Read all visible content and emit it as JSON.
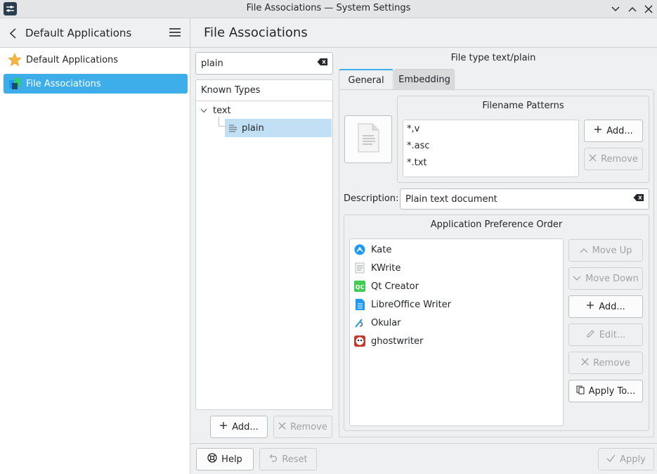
{
  "window": {
    "title": "File Associations — System Settings"
  },
  "header": {
    "back_label": "Default Applications",
    "page_title": "File Associations"
  },
  "sidebar": {
    "items": [
      {
        "label": "Default Applications"
      },
      {
        "label": "File Associations"
      }
    ]
  },
  "left_panel": {
    "search_value": "plain",
    "tree_header": "Known Types",
    "tree": {
      "parent": "text",
      "child": "plain"
    },
    "add_label": "Add...",
    "remove_label": "Remove"
  },
  "right_panel": {
    "file_type_title": "File type text/plain",
    "tabs": [
      {
        "label": "General"
      },
      {
        "label": "Embedding"
      }
    ],
    "patterns_title": "Filename Patterns",
    "patterns": [
      "*,v",
      "*.asc",
      "*.txt"
    ],
    "patterns_add": "Add...",
    "patterns_remove": "Remove",
    "description_label": "Description:",
    "description_value": "Plain text document",
    "app_order_title": "Application Preference Order",
    "apps": [
      {
        "name": "Kate",
        "icon": "kate-icon"
      },
      {
        "name": "KWrite",
        "icon": "kwrite-icon"
      },
      {
        "name": "Qt Creator",
        "icon": "qtcreator-icon"
      },
      {
        "name": "LibreOffice Writer",
        "icon": "writer-icon"
      },
      {
        "name": "Okular",
        "icon": "okular-icon"
      },
      {
        "name": "ghostwriter",
        "icon": "ghostwriter-icon"
      }
    ],
    "app_buttons": {
      "move_up": "Move Up",
      "move_down": "Move Down",
      "add": "Add...",
      "edit": "Edit...",
      "remove": "Remove",
      "apply_to": "Apply To..."
    }
  },
  "footer": {
    "help": "Help",
    "reset": "Reset",
    "apply": "Apply"
  },
  "colors": {
    "accent": "#3daee9",
    "selection_light": "#c2e0f5"
  }
}
